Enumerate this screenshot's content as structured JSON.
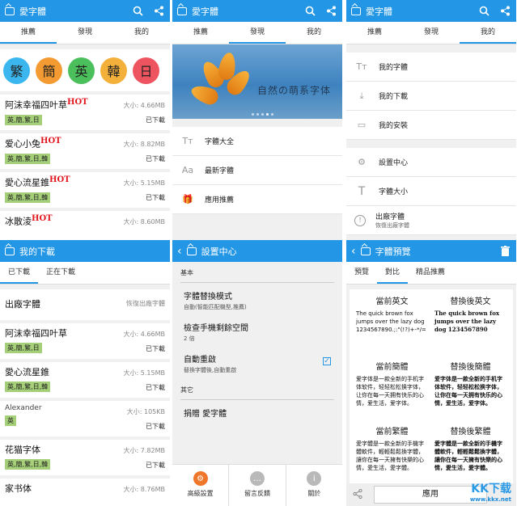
{
  "app_title": "愛字體",
  "tabs": [
    "推薦",
    "發現",
    "我的"
  ],
  "circles": [
    {
      "ch": "繁",
      "color": "#3bb6ef"
    },
    {
      "ch": "簡",
      "color": "#f39a32"
    },
    {
      "ch": "英",
      "color": "#4bbf5b"
    },
    {
      "ch": "韓",
      "color": "#f3b13c"
    },
    {
      "ch": "日",
      "color": "#ee5360"
    }
  ],
  "p1_items": [
    {
      "name": "阿沫幸福四叶草",
      "hot": "HOT",
      "size": "大小: 4.66MB",
      "langs": "英,簡,繁,日",
      "status": "已下載"
    },
    {
      "name": "爱心小兔",
      "hot": "HOT",
      "size": "大小: 8.82MB",
      "langs": "英,簡,繁,日,韓",
      "status": "已下載"
    },
    {
      "name": "愛心流星錐",
      "hot": "HOT",
      "size": "大小: 5.15MB",
      "langs": "英,簡,繁,日,韓",
      "status": "已下載"
    },
    {
      "name": "冰散淩",
      "hot": "HOT",
      "size": "大小: 8.60MB"
    }
  ],
  "p2": {
    "banner_text": "自然の萌系字体",
    "menu": [
      "字體大全",
      "最新字體",
      "應用推薦"
    ]
  },
  "p3": {
    "group1": [
      "我的字體",
      "我的下載",
      "我的安裝"
    ],
    "group2": [
      {
        "label": "設置中心"
      },
      {
        "label": "字體大小"
      },
      {
        "label": "出廠字體",
        "sub": "恢復出廠字體"
      }
    ]
  },
  "p4": {
    "title": "我的下載",
    "tabs": [
      "已下載",
      "正在下載"
    ],
    "factory": {
      "name": "出廠字體",
      "action": "恢復出廠字體"
    },
    "items": [
      {
        "name": "阿沫幸福四叶草",
        "size": "大小: 4.66MB",
        "langs": "英,簡,繁,日",
        "status": "已下載"
      },
      {
        "name": "愛心流星錐",
        "size": "大小: 5.15MB",
        "langs": "英,簡,繁,日,韓",
        "status": "已下載"
      },
      {
        "name": "Alexander",
        "size": "大小: 105KB",
        "langs": "英",
        "status": "已下載"
      },
      {
        "name": "花猫字体",
        "size": "大小: 7.82MB",
        "langs": "英,簡,繁,日,韓",
        "status": "已下載"
      },
      {
        "name": "家书体",
        "size": "大小: 8.76MB"
      }
    ]
  },
  "p5": {
    "title": "設置中心",
    "sec_basic": "基本",
    "items": [
      {
        "t": "字體替換模式",
        "d": "自動(智能匹配機型,推薦)"
      },
      {
        "t": "檢查手機剩餘空間",
        "d": "2 倍"
      },
      {
        "t": "自動重啟",
        "d": "替換字體後,自動重啟",
        "checked": true
      }
    ],
    "sec_other": "其它",
    "donate": "捐贈 愛字體",
    "bottom": [
      {
        "label": "高級設置",
        "color": "#f0762a",
        "icon": "⚙"
      },
      {
        "label": "留言反饋",
        "color": "#b9b9b9",
        "icon": "…"
      },
      {
        "label": "關於",
        "color": "#b9b9b9",
        "icon": "i"
      }
    ]
  },
  "p6": {
    "title": "字體預覽",
    "tabs": [
      "預覽",
      "對比",
      "精品推薦"
    ],
    "cells": [
      {
        "h": "當前英文",
        "b": "The quick brown fox jumps over the lazy dog 1234567890.;:\"(!?)+-*/="
      },
      {
        "h": "替換後英文",
        "b": "The quick brown fox jumps over the lazy dog 1234567890"
      },
      {
        "h": "當前簡體",
        "b": "爱字体是一款全新的手机字体软件，轻轻松松换字体，让你在每一天拥有快乐的心情，爱生活，爱字体。"
      },
      {
        "h": "替換後簡體",
        "b": "爱字体是一款全新的手机字体软件，轻轻松松换字体，让你在每一天拥有快乐的心情，爱生活，爱字体。"
      },
      {
        "h": "當前繁體",
        "b": "愛字體是一款全新的手機字體軟件，輕輕鬆鬆換字體，讓你在每一天擁有快樂的心情，愛生活，愛字體。"
      },
      {
        "h": "替換後繁體",
        "b": "愛字體是一款全新的手機字體軟件，輕輕鬆鬆換字體，讓你在每一天擁有快樂的心情，愛生活，愛字體。"
      }
    ],
    "apply": "應用"
  },
  "watermark": {
    "big": "KK下载",
    "small": "www.kkx.net"
  }
}
